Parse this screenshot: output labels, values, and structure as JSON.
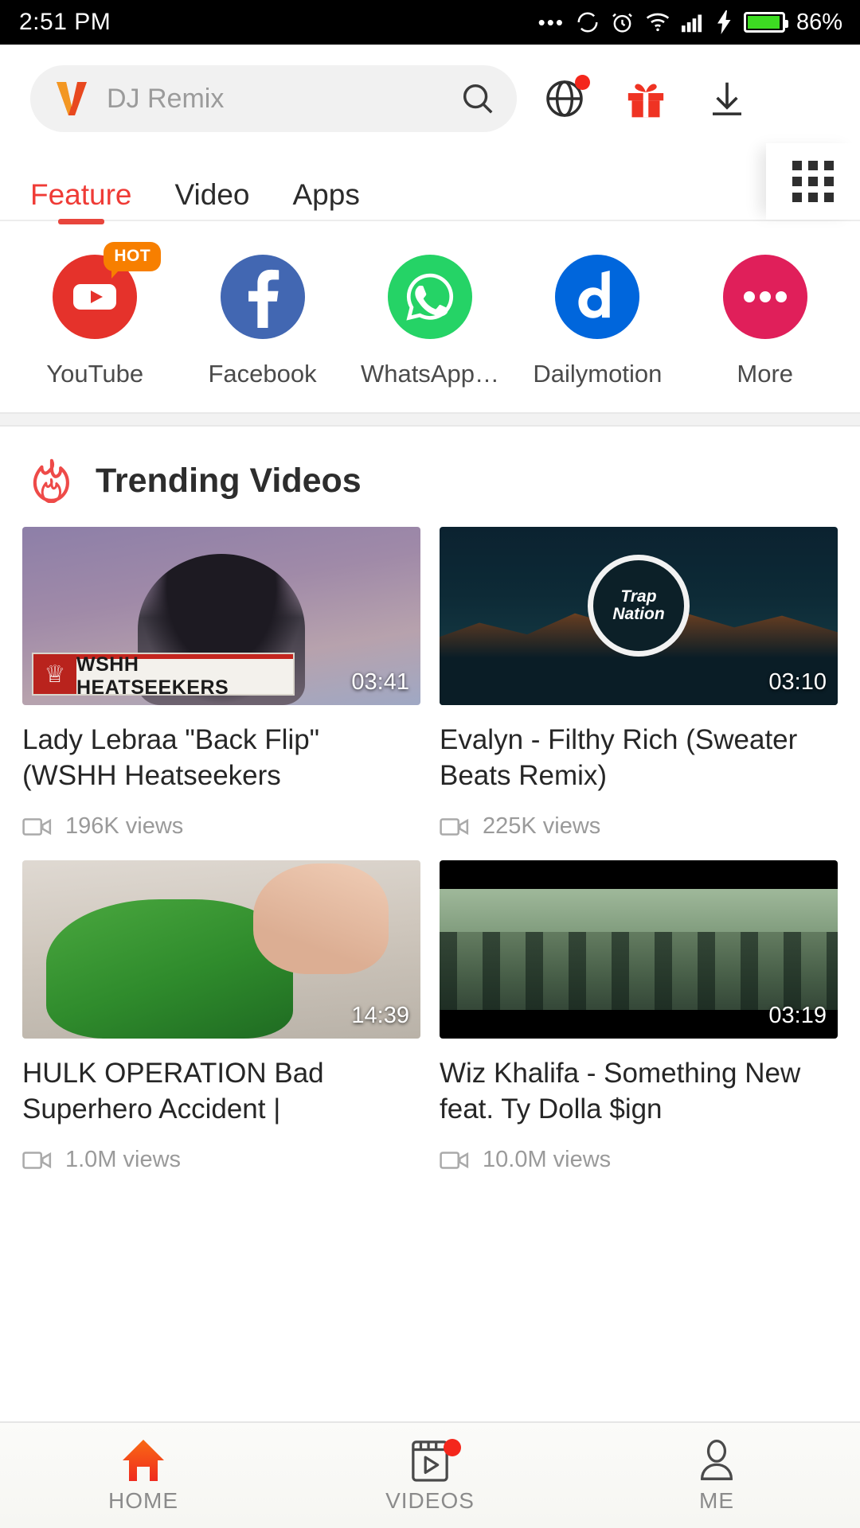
{
  "status_bar": {
    "time": "2:51 PM",
    "battery_percent": "86%",
    "icons": [
      "more-dots-icon",
      "sync-icon",
      "alarm-icon",
      "wifi-icon",
      "signal-icon",
      "charging-icon",
      "battery-icon"
    ]
  },
  "search": {
    "logo": "vidmate-v-logo",
    "placeholder": "DJ Remix",
    "value": "",
    "search_icon": "search-icon"
  },
  "top_actions": [
    {
      "name": "globe-icon",
      "has_badge": true
    },
    {
      "name": "gift-icon",
      "has_badge": false
    },
    {
      "name": "download-icon",
      "has_badge": false
    }
  ],
  "tabs": {
    "items": [
      {
        "label": "Feature",
        "active": true
      },
      {
        "label": "Video",
        "active": false
      },
      {
        "label": "Apps",
        "active": false
      }
    ],
    "grid_button": "grid-menu-icon",
    "active_color": "#ef3b36"
  },
  "apps": [
    {
      "label": "YouTube",
      "badge": "HOT",
      "color": "#e5322b",
      "icon": "youtube-icon"
    },
    {
      "label": "Facebook",
      "badge": "",
      "color": "#4267b2",
      "icon": "facebook-icon"
    },
    {
      "label": "WhatsApp…",
      "badge": "",
      "color": "#25d366",
      "icon": "whatsapp-icon"
    },
    {
      "label": "Dailymotion",
      "badge": "",
      "color": "#0066dc",
      "icon": "dailymotion-icon"
    },
    {
      "label": "More",
      "badge": "",
      "color": "#e01f5a",
      "icon": "more-dots-icon"
    }
  ],
  "trending": {
    "icon": "flame-icon",
    "title": "Trending Videos",
    "videos": [
      {
        "title": "Lady Lebraa \"Back Flip\" (WSHH Heatseekers",
        "duration": "03:41",
        "views": "196K views",
        "overlay_banner": "WSHH HEATSEEKERS"
      },
      {
        "title": "Evalyn - Filthy Rich (Sweater Beats Remix)",
        "duration": "03:10",
        "views": "225K views",
        "overlay_logo": "Trap Nation"
      },
      {
        "title": "HULK OPERATION Bad Superhero Accident |",
        "duration": "14:39",
        "views": "1.0M views"
      },
      {
        "title": "Wiz Khalifa - Something New feat. Ty Dolla $ign",
        "duration": "03:19",
        "views": "10.0M views"
      }
    ]
  },
  "bottom_nav": [
    {
      "label": "HOME",
      "icon": "home-icon",
      "active": true,
      "badge": false
    },
    {
      "label": "VIDEOS",
      "icon": "videos-icon",
      "active": false,
      "badge": true
    },
    {
      "label": "ME",
      "icon": "person-icon",
      "active": false,
      "badge": false
    }
  ]
}
